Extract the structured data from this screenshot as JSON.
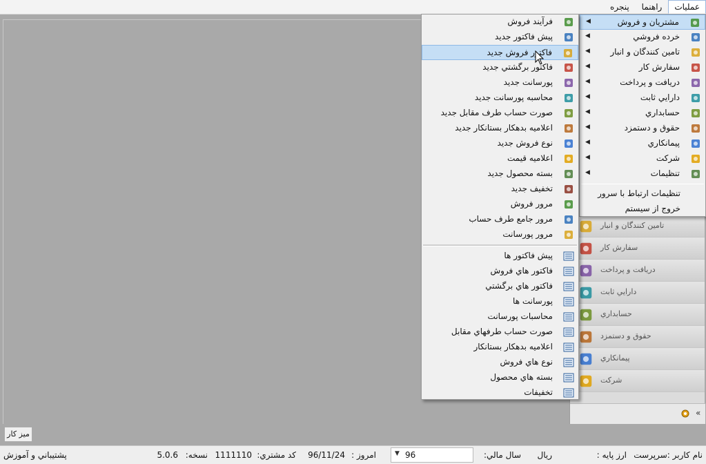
{
  "menubar": {
    "items": [
      {
        "label": "عمليات",
        "active": true
      },
      {
        "label": "راهنما",
        "active": false
      },
      {
        "label": "پنجره",
        "active": false
      }
    ]
  },
  "main_menu": {
    "items": [
      {
        "label": "مشتريان و فروش",
        "icon": "customers-sales-icon",
        "submenu": true,
        "highlighted": true
      },
      {
        "label": "خرده فروشي",
        "icon": "retail-icon",
        "submenu": true
      },
      {
        "label": "تامين كنندگان و انبار",
        "icon": "suppliers-icon",
        "submenu": true
      },
      {
        "label": "سفارش كار",
        "icon": "work-order-icon",
        "submenu": true
      },
      {
        "label": "دريافت و پرداخت",
        "icon": "payment-icon",
        "submenu": true
      },
      {
        "label": "دارايي ثابت",
        "icon": "fixed-asset-icon",
        "submenu": true
      },
      {
        "label": "حسابداري",
        "icon": "accounting-icon",
        "submenu": true
      },
      {
        "label": "حقوق و دستمزد",
        "icon": "payroll-icon",
        "submenu": true
      },
      {
        "label": "پيمانكاري",
        "icon": "contracting-icon",
        "submenu": true
      },
      {
        "label": "شركت",
        "icon": "company-icon",
        "submenu": true
      },
      {
        "label": "تنظيمات",
        "icon": "settings-icon",
        "submenu": true
      }
    ],
    "extra_items": [
      {
        "label": "تنظيمات ارتباط با سرور"
      },
      {
        "label": "خروج از سيستم"
      }
    ]
  },
  "sub_menu": {
    "group1": [
      {
        "label": "فرآيند فروش",
        "icon": "sales-process-icon"
      },
      {
        "label": "پيش فاكتور جديد",
        "icon": "new-proforma-icon"
      },
      {
        "label": "فاكتور فروش جديد",
        "icon": "new-invoice-icon",
        "highlighted": true
      },
      {
        "label": "فاكتور برگشتي جديد",
        "icon": "new-return-invoice-icon"
      },
      {
        "label": "پورسانت جديد",
        "icon": "new-commission-icon"
      },
      {
        "label": "محاسبه پورسانت جديد",
        "icon": "commission-calc-icon"
      },
      {
        "label": "صورت حساب طرف مقابل جديد",
        "icon": "statement-icon"
      },
      {
        "label": "اعلاميه بدهكار بستانكار جديد",
        "icon": "debit-credit-note-icon"
      },
      {
        "label": "نوع فروش جديد",
        "icon": "sale-type-icon"
      },
      {
        "label": "اعلاميه قيمت",
        "icon": "price-notice-icon"
      },
      {
        "label": "بسته محصول جديد",
        "icon": "product-bundle-icon"
      },
      {
        "label": "تخفيف جديد",
        "icon": "discount-icon"
      },
      {
        "label": "مرور فروش",
        "icon": "sales-review-icon"
      },
      {
        "label": "مرور جامع طرف حساب",
        "icon": "account-review-icon"
      },
      {
        "label": "مرور پورسانت",
        "icon": "commission-review-icon"
      }
    ],
    "group2": [
      {
        "label": "پيش فاكتور ها",
        "icon": "list-icon"
      },
      {
        "label": "فاكتور هاي فروش",
        "icon": "list-icon"
      },
      {
        "label": "فاكتور هاي برگشتي",
        "icon": "list-icon"
      },
      {
        "label": "پورسانت ها",
        "icon": "list-icon"
      },
      {
        "label": "محاسبات پورسانت",
        "icon": "list-icon"
      },
      {
        "label": "صورت حساب طرفهاي مقابل",
        "icon": "list-icon"
      },
      {
        "label": "اعلاميه بدهكار بستانكار",
        "icon": "list-icon"
      },
      {
        "label": "نوع هاي فروش",
        "icon": "list-icon"
      },
      {
        "label": "بسته هاي محصول",
        "icon": "list-icon"
      },
      {
        "label": "تخفيفات",
        "icon": "list-icon"
      }
    ]
  },
  "nav_panel": {
    "items": [
      {
        "label": "تامين كنندگان و انبار",
        "icon": "suppliers-nav-icon"
      },
      {
        "label": "سفارش كار",
        "icon": "work-order-nav-icon"
      },
      {
        "label": "دريافت و پرداخت",
        "icon": "payment-nav-icon"
      },
      {
        "label": "دارايي ثابت",
        "icon": "fixed-asset-nav-icon"
      },
      {
        "label": "حسابداري",
        "icon": "accounting-nav-icon"
      },
      {
        "label": "حقوق و دستمزد",
        "icon": "payroll-nav-icon"
      },
      {
        "label": "پيمانكاري",
        "icon": "contracting-nav-icon"
      },
      {
        "label": "شركت",
        "icon": "company-nav-icon"
      }
    ],
    "footer_chevron": "«"
  },
  "desk_tab": "ميز كار",
  "status": {
    "user": "نام كاربر :سرپرست",
    "base_currency_label": "ارز پايه :",
    "base_currency_value": "ريال",
    "fiscal_year_label": "سال مالي:",
    "fiscal_year_value": "96",
    "today_label": "امروز :",
    "today_value": "96/11/24",
    "customer_code_label": "كد مشتري:",
    "customer_code_value": "1111110",
    "version_label": "نسخه:",
    "version_value": "5.0.6",
    "support": "پشتيباني و آموزش"
  }
}
